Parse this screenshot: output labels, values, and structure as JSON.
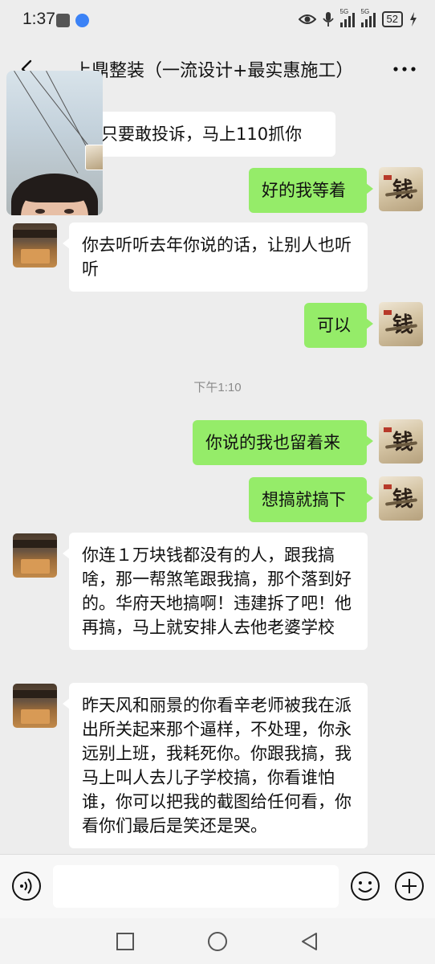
{
  "status_bar": {
    "time": "1:37",
    "signal_labels": [
      "5G",
      "5G"
    ],
    "battery": "52"
  },
  "header": {
    "title": "上鼎整装（一流设计+最实惠施工）"
  },
  "messages": [
    {
      "side": "in",
      "text": "只要敢投诉，马上110抓你"
    },
    {
      "side": "out",
      "text": "好的我等着"
    },
    {
      "side": "in",
      "text": "你去听听去年你说的话，让别人也听听"
    },
    {
      "side": "out",
      "text": "可以"
    },
    {
      "type": "time",
      "text": "下午1:10"
    },
    {
      "side": "out",
      "text": "你说的我也留着来"
    },
    {
      "side": "out",
      "text": "想搞就搞下"
    },
    {
      "side": "in",
      "text": "你连１万块钱都没有的人，跟我搞啥，那一帮煞笔跟我搞，那个落到好的。华府天地搞啊！违建拆了吧！他再搞，马上就安排人去他老婆学校"
    },
    {
      "side": "in",
      "text": "昨天风和丽景的你看辛老师被我在派出所关起来那个逼样，不处理，你永远别上班，我耗死你。你跟我搞，我马上叫人去儿子学校搞，你看谁怕谁，你可以把我的截图给任何看，你看你们最后是笑还是哭。"
    }
  ],
  "self_avatar_glyph": "钱",
  "input": {
    "value": "",
    "placeholder": ""
  },
  "icons": {
    "back": "back-arrow-icon",
    "more": "more-dots-icon",
    "voice": "voice-icon",
    "emoji": "emoji-icon",
    "plus": "plus-icon",
    "nav_recent": "square-icon",
    "nav_home": "circle-icon",
    "nav_back": "triangle-icon"
  },
  "colors": {
    "outgoing_bubble": "#95ec69",
    "incoming_bubble": "#ffffff",
    "background": "#ededed"
  }
}
